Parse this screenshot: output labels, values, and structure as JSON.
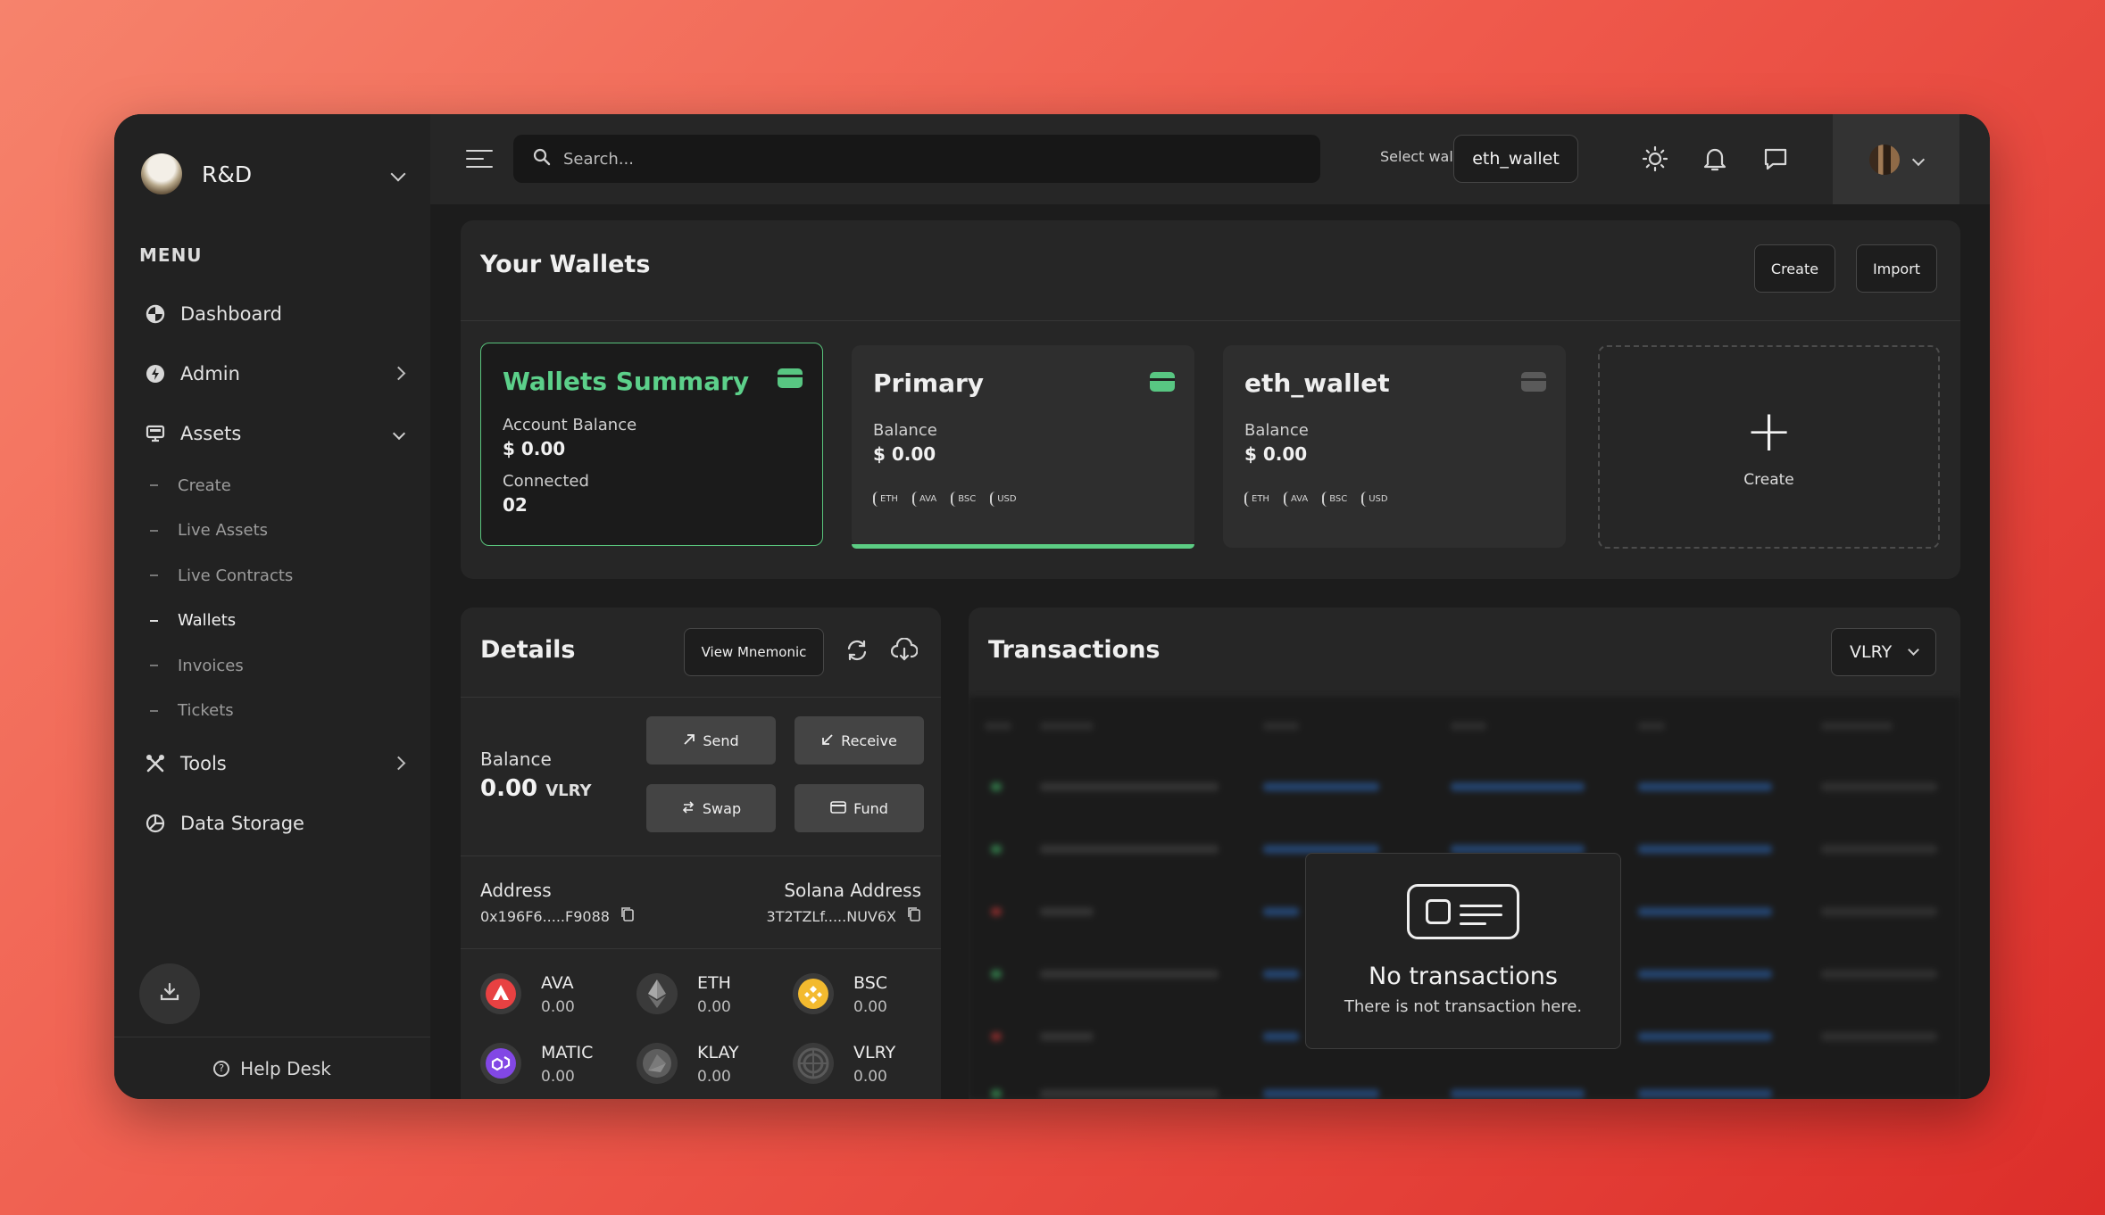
{
  "org": {
    "name": "R&D"
  },
  "sidebar": {
    "menu_label": "MENU",
    "items": [
      {
        "label": "Dashboard",
        "icon": "pie-chart-icon"
      },
      {
        "label": "Admin",
        "icon": "lightning-icon"
      },
      {
        "label": "Assets",
        "icon": "monitor-icon"
      },
      {
        "label": "Tools",
        "icon": "tools-icon"
      },
      {
        "label": "Data Storage",
        "icon": "storage-icon"
      }
    ],
    "subitems": [
      "Create",
      "Live Assets",
      "Live Contracts",
      "Wallets",
      "Invoices",
      "Tickets"
    ],
    "active_subitem": "Wallets",
    "help": "Help Desk"
  },
  "topbar": {
    "search_placeholder": "Search...",
    "select_wallet_label": "Select wallet",
    "selected_wallet": "eth_wallet"
  },
  "wallets": {
    "title": "Your Wallets",
    "create_label": "Create",
    "import_label": "Import",
    "summary": {
      "title": "Wallets Summary",
      "balance_label": "Account Balance",
      "balance": "$ 0.00",
      "connected_label": "Connected",
      "connected": "02"
    },
    "cards": [
      {
        "title": "Primary",
        "balance_label": "Balance",
        "balance": "$ 0.00",
        "tags": [
          "ETH",
          "AVA",
          "BSC",
          "USD"
        ]
      },
      {
        "title": "eth_wallet",
        "balance_label": "Balance",
        "balance": "$ 0.00",
        "tags": [
          "ETH",
          "AVA",
          "BSC",
          "USD"
        ]
      }
    ],
    "create_card_label": "Create"
  },
  "details": {
    "title": "Details",
    "view_mnemonic": "View Mnemonic",
    "balance_label": "Balance",
    "balance_value": "0.00",
    "balance_unit": "VLRY",
    "actions": {
      "send": "Send",
      "receive": "Receive",
      "swap": "Swap",
      "fund": "Fund"
    },
    "address_label": "Address",
    "address": "0x196F6.....F9088",
    "solana_label": "Solana Address",
    "solana": "3T2TZLf.....NUV6X",
    "coins": [
      {
        "name": "AVA",
        "value": "0.00",
        "color": "#e84142"
      },
      {
        "name": "ETH",
        "value": "0.00",
        "color": "#5c5c5c"
      },
      {
        "name": "BSC",
        "value": "0.00",
        "color": "#f3ba2f"
      },
      {
        "name": "MATIC",
        "value": "0.00",
        "color": "#8247e5"
      },
      {
        "name": "KLAY",
        "value": "0.00",
        "color": "#5a5a5a"
      },
      {
        "name": "VLRY",
        "value": "0.00",
        "color": "#4a4a4a"
      }
    ]
  },
  "transactions": {
    "title": "Transactions",
    "currency": "VLRY",
    "empty_title": "No transactions",
    "empty_subtitle": "There is not transaction here."
  }
}
